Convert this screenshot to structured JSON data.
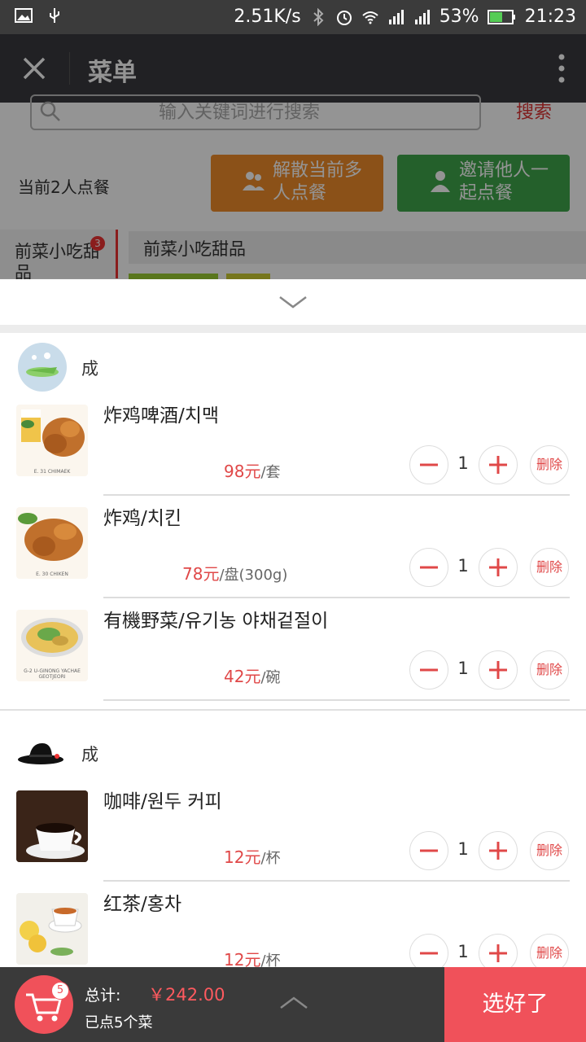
{
  "status_bar": {
    "speed": "2.51K/s",
    "battery": "53%",
    "time": "21:23"
  },
  "nav": {
    "title": "菜单"
  },
  "background_page": {
    "search_placeholder": "输入关键词进行搜索",
    "search_button": "搜索",
    "group_info": "当前2人点餐",
    "dissolve_button": "解散当前多人点餐",
    "invite_button": "邀请他人一起点餐",
    "category_tab": "前菜小吃甜品",
    "category_badge": "3",
    "category_header": "前菜小吃甜品"
  },
  "groups": [
    {
      "owner": "成",
      "items": [
        {
          "name": "炸鸡啤酒/치맥",
          "price": "98元",
          "unit": "/套",
          "qty": "1",
          "thumb_caption": "E. 31 CHIMAEK"
        },
        {
          "name": "炸鸡/치킨",
          "price": "78元",
          "unit": "/盘(300g)",
          "qty": "1",
          "thumb_caption": "E. 30 CHIKEN"
        },
        {
          "name": "有機野菜/유기농 야채겉절이",
          "price": "42元",
          "unit": "/碗",
          "qty": "1",
          "thumb_caption": "G-2 U-GINONG YACHAE GEOTJEORI"
        }
      ]
    },
    {
      "owner": "成",
      "items": [
        {
          "name": "咖啡/원두 커피",
          "price": "12元",
          "unit": "/杯",
          "qty": "1"
        },
        {
          "name": "红茶/홍차",
          "price": "12元",
          "unit": "/杯",
          "qty": "1"
        }
      ]
    }
  ],
  "delete_label": "删除",
  "footer": {
    "total_label": "总计:",
    "total_value": "￥242.00",
    "count_label": "已点5个菜",
    "cart_badge": "5",
    "confirm_button": "选好了"
  },
  "colors": {
    "accent": "#f0515a",
    "price": "#e04848",
    "navbar": "#393a3e"
  }
}
